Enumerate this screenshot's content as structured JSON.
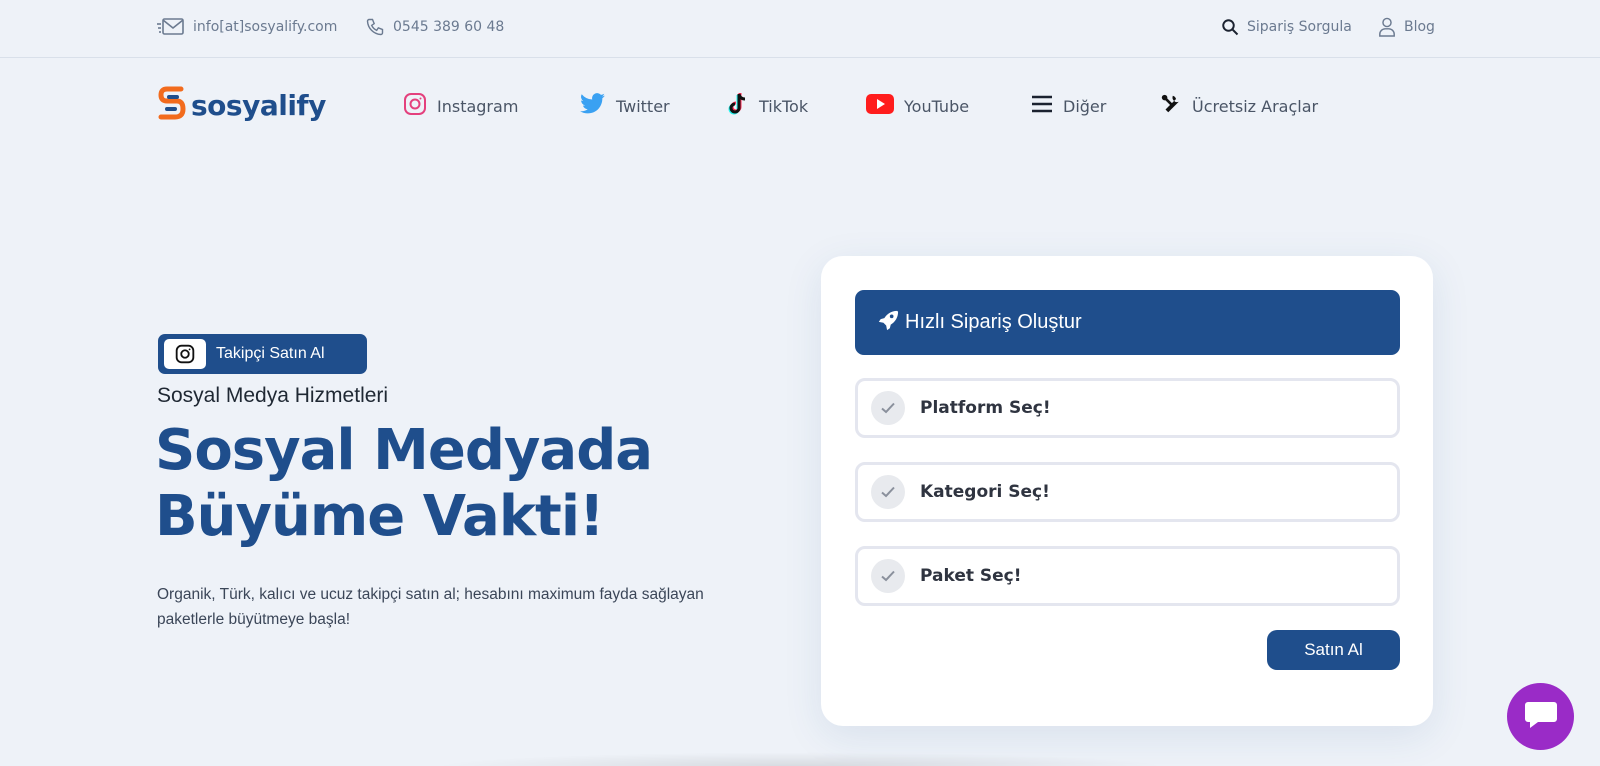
{
  "topbar": {
    "email": "info[at]sosyalify.com",
    "phone": "0545 389 60 48",
    "order_query": "Sipariş Sorgula",
    "blog": "Blog"
  },
  "brand": {
    "name": "sosyalify",
    "accent": "#1f4e8c",
    "logo_orange": "#f26b1d"
  },
  "nav": {
    "items": [
      {
        "label": "Instagram",
        "icon": "instagram-icon"
      },
      {
        "label": "Twitter",
        "icon": "twitter-icon"
      },
      {
        "label": "TikTok",
        "icon": "tiktok-icon"
      },
      {
        "label": "YouTube",
        "icon": "youtube-icon"
      },
      {
        "label": "Diğer",
        "icon": "menu-icon"
      },
      {
        "label": "Ücretsiz Araçlar",
        "icon": "tools-icon"
      }
    ]
  },
  "hero": {
    "badge": "Takipçi Satın Al",
    "eyebrow": "Sosyal Medya Hizmetleri",
    "title_line1": "Sosyal Medyada",
    "title_line2": "Büyüme Vakti!",
    "description": "Organik, Türk, kalıcı ve ucuz takipçi satın al; hesabını maximum fayda sağlayan paketlerle büyütmeye başla!"
  },
  "order_card": {
    "header": "Hızlı Sipariş Oluştur",
    "steps": [
      {
        "label": "Platform Seç!"
      },
      {
        "label": "Kategori Seç!"
      },
      {
        "label": "Paket Seç!"
      }
    ],
    "buy_label": "Satın Al"
  },
  "colors": {
    "chat": "#9a2bc7",
    "background": "#eef2f8"
  }
}
